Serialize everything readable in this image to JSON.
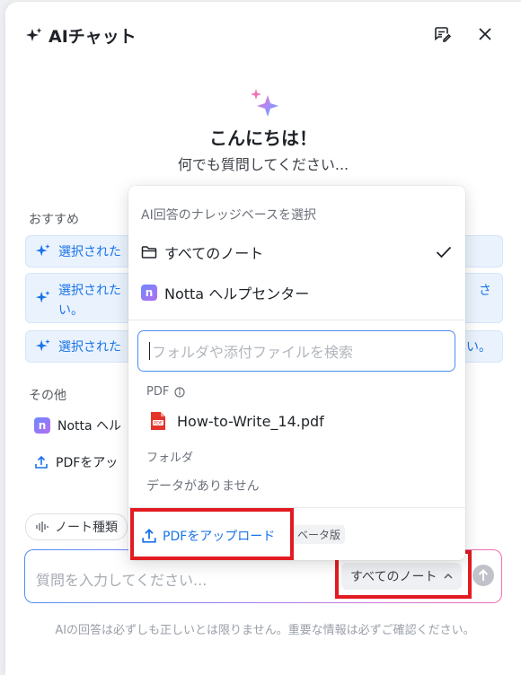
{
  "header": {
    "title": "AIチャット",
    "sparkle_icon": "sparkle-icon",
    "compose_icon": "compose-icon",
    "close_icon": "close-icon"
  },
  "greeting": {
    "title": "こんにちは！",
    "subtitle": "何でも質問してください..."
  },
  "suggestions": {
    "label": "おすすめ",
    "items": [
      {
        "text": "選択された"
      },
      {
        "text": "選択された",
        "tail": "さ",
        "tail2": "い。",
        "tail3": "い。"
      },
      {
        "text": "選択された",
        "tail": "い。"
      }
    ]
  },
  "other": {
    "label": "その他",
    "items": [
      {
        "text": "Notta ヘル"
      },
      {
        "text": "PDFをアッ"
      }
    ]
  },
  "note_type": {
    "label": "ノート種類"
  },
  "input": {
    "placeholder": "質問を入力してください...",
    "kb_button": "すべてのノート"
  },
  "disclaimer": "AIの回答は必ずしも正しいとは限りません。重要な情報は必ずご確認ください。",
  "dropdown": {
    "header": "AI回答のナレッジベースを選択",
    "options": [
      {
        "label": "すべてのノート",
        "icon": "folder-icon",
        "selected": true
      },
      {
        "label": "Notta ヘルプセンター",
        "icon": "notta-logo-icon",
        "selected": false
      }
    ],
    "search_placeholder": "フォルダや添付ファイルを検索",
    "pdf_section": "PDF",
    "pdf_file": "How-to-Write_14.pdf",
    "folder_section": "フォルダ",
    "no_data": "データがありません",
    "upload_label": "PDFをアップロード",
    "beta_label": "ベータ版"
  },
  "colors": {
    "accent": "#1a73e8",
    "highlight": "#e21b22",
    "suggestion_bg": "#eaf3fd"
  }
}
